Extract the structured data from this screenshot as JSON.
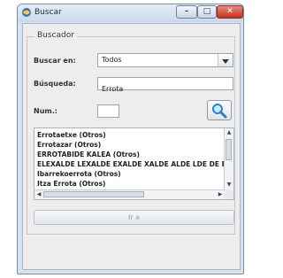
{
  "window": {
    "title": "Buscar",
    "controls": {
      "minimize": "–",
      "maximize": "□",
      "close": "✕"
    },
    "close_color": "#c4301f"
  },
  "form": {
    "group_title": "Buscador",
    "buscar_en": {
      "label": "Buscar en:",
      "selected": "Todos"
    },
    "busqueda": {
      "label": "Búsqueda:",
      "value": "Errota"
    },
    "num": {
      "label": "Num.:",
      "value": ""
    }
  },
  "results": {
    "items": [
      "Errotaetxe  (Otros)",
      "Errotazar  (Otros)",
      "ERROTABIDE KALEA  (Otros)",
      "ELEXALDE LEXALDE EXALDE XALDE ALDE LDE DE E",
      "Ibarrekoerrota  (Otros)",
      "Itza Errota  (Otros)"
    ]
  },
  "actions": {
    "ir_label": "Ir a"
  }
}
